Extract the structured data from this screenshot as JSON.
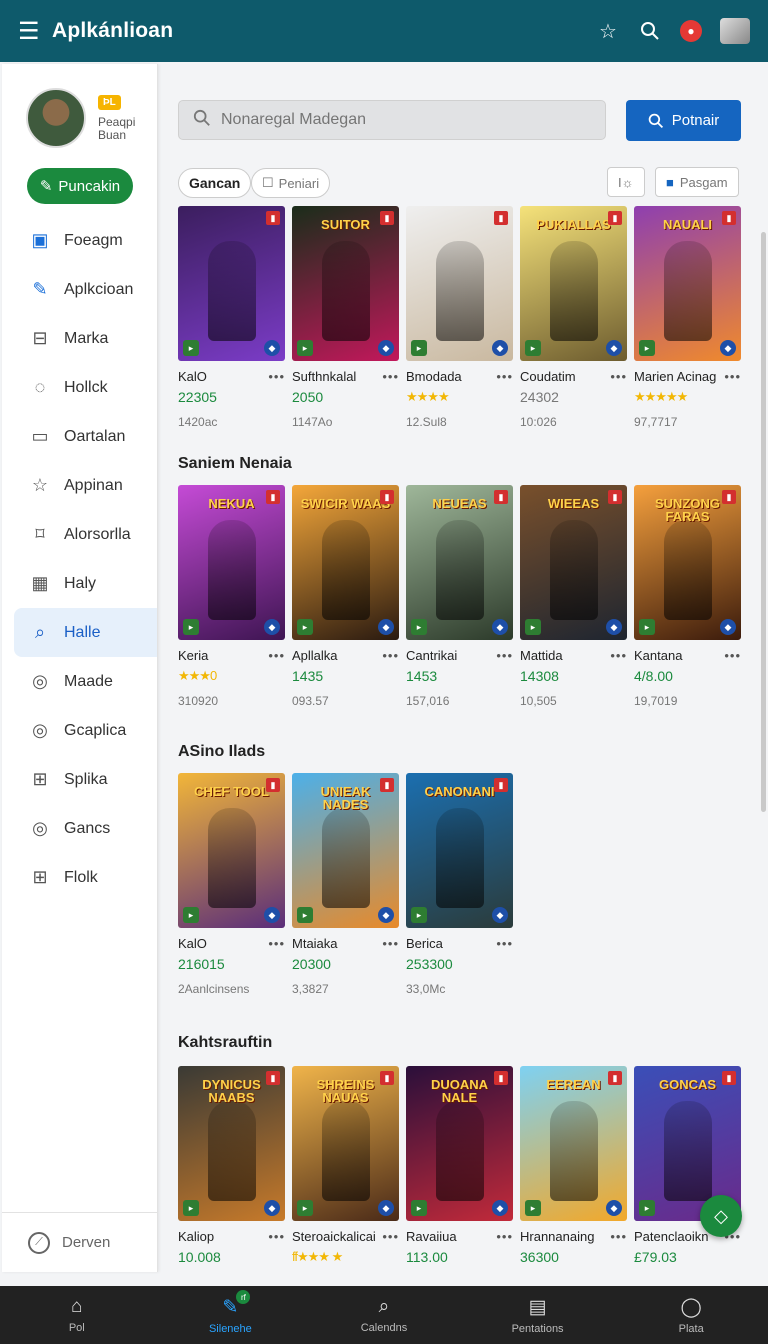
{
  "topbar": {
    "title": "Aplkánlioan",
    "menu_icon": "hamburger-icon",
    "icons": [
      "star-icon",
      "search-icon",
      "notification-icon",
      "avatar-icon"
    ]
  },
  "sidebar": {
    "profile_badge": "ÞL",
    "profile_name": "Peaqpi",
    "profile_sub": "Buan",
    "primary_button": "Puncakin",
    "items": [
      {
        "label": "Foeagm",
        "icon": "image-icon"
      },
      {
        "label": "Aplkcioan",
        "icon": "pen-icon"
      },
      {
        "label": "Marka",
        "icon": "bag-icon"
      },
      {
        "label": "Hollck",
        "icon": "chat-icon"
      },
      {
        "label": "Oartalan",
        "icon": "tray-icon"
      },
      {
        "label": "Appinan",
        "icon": "star-icon"
      },
      {
        "label": "Alorsorlla",
        "icon": "tag-icon"
      },
      {
        "label": "Haly",
        "icon": "calendar-icon"
      },
      {
        "label": "Halle",
        "icon": "search-icon"
      },
      {
        "label": "Maade",
        "icon": "compass-icon"
      },
      {
        "label": "Gcaplica",
        "icon": "compass-icon"
      },
      {
        "label": "Splika",
        "icon": "gift-icon"
      },
      {
        "label": "Gancs",
        "icon": "compass-icon"
      },
      {
        "label": "Flolk",
        "icon": "gift-icon"
      }
    ],
    "active_index": 8,
    "footer": "Derven"
  },
  "search": {
    "placeholder": "Nonaregal Madegan",
    "button": "Potnair"
  },
  "filters": {
    "selected": "Gancan",
    "chip2": "Peniari",
    "chip3": "I☼",
    "chip4": "Pasgam"
  },
  "sections": [
    {
      "title": "",
      "cards": [
        {
          "name": "KalO",
          "value": "22305",
          "sub": "1420ac",
          "colors": [
            "#3b1e5e",
            "#7b3cc7"
          ]
        },
        {
          "name": "Sufthnkalal",
          "value": "2050",
          "sub": "1147Ao",
          "colors": [
            "#1a2d1a",
            "#c2185b"
          ]
        },
        {
          "name": "Bmodada",
          "stars": "★★★★",
          "sub": "12.Sul8",
          "colors": [
            "#efefef",
            "#c9b89f"
          ]
        },
        {
          "name": "Coudatim",
          "value": "24302",
          "value_gray": true,
          "sub": "10:026",
          "colors": [
            "#f5e27a",
            "#6d5c2f"
          ]
        },
        {
          "name": "Marien Acinag",
          "stars": "★★★★★",
          "sub": "97,7717",
          "colors": [
            "#8e3fb0",
            "#f08a2c"
          ]
        }
      ]
    },
    {
      "title": "Saniem Nenaia",
      "cards": [
        {
          "name": "Keria",
          "stars": "★★★0",
          "sub": "310920",
          "colors": [
            "#c54bd6",
            "#3e1552"
          ]
        },
        {
          "name": "Apllalka",
          "value": "1435",
          "sub": "093.57",
          "colors": [
            "#f4a73a",
            "#2a1a10"
          ]
        },
        {
          "name": "Cantrikai",
          "value": "1453",
          "sub": "157,016",
          "colors": [
            "#9fb79a",
            "#2c3a2a"
          ]
        },
        {
          "name": "Mattida",
          "value": "14308",
          "sub": "10,505",
          "colors": [
            "#79502c",
            "#1e2530"
          ]
        },
        {
          "name": "Kantana",
          "value": "4/8.00",
          "sub": "19,7019",
          "colors": [
            "#f5a03d",
            "#3b1b0c"
          ]
        }
      ]
    },
    {
      "title": "ASino Ilads",
      "cards": [
        {
          "name": "KalO",
          "value": "216015",
          "sub": "2Aanlcinsens",
          "colors": [
            "#f2b639",
            "#5a2d7a"
          ]
        },
        {
          "name": "Mtaiaka",
          "value": "20300",
          "sub": "3,3827",
          "colors": [
            "#4cb0e9",
            "#e88a2a"
          ]
        },
        {
          "name": "Berica",
          "value": "253300",
          "sub": "33,0Mc",
          "colors": [
            "#1b6fb0",
            "#2b3b3a"
          ]
        }
      ]
    },
    {
      "title": "Kahtsrauftin",
      "cards": [
        {
          "name": "Kaliop",
          "value": "10.008",
          "sub": "",
          "colors": [
            "#3a3a35",
            "#c77a2a"
          ]
        },
        {
          "name": "Steroaickalicai",
          "stars": "ff★★★ ★",
          "sub": "",
          "colors": [
            "#f0b44a",
            "#4a2a18"
          ]
        },
        {
          "name": "Ravaiiua",
          "value": "113.00",
          "sub": "",
          "colors": [
            "#2a0f3a",
            "#c22a3a"
          ]
        },
        {
          "name": "Hrannanaing",
          "value": "36300",
          "sub": "",
          "colors": [
            "#7ed1f2",
            "#f2a82a"
          ]
        },
        {
          "name": "Patenclaoikn",
          "value": "£79.03",
          "sub": "",
          "colors": [
            "#3a4fb8",
            "#6a2a8a"
          ]
        }
      ]
    }
  ],
  "card_titles": [
    "",
    "SUITOR",
    "",
    "PUKIALLAS",
    "NAUALI",
    "NEKUA",
    "SWICIR WAAS",
    "NEUEAS",
    "WIEEAS",
    "SUNZONG FARAS",
    "CHEF TOOL",
    "UNIEAK NADES",
    "CANONANI",
    "DYNICUS NAABS",
    "SHREINS NAUAS",
    "DUOANA NALE",
    "EEREAN",
    "GONCAS"
  ],
  "bottomnav": [
    {
      "label": "Pol",
      "icon": "home-icon"
    },
    {
      "label": "Silenehe",
      "icon": "edit-icon",
      "badge": "rf"
    },
    {
      "label": "Calendns",
      "icon": "search-icon"
    },
    {
      "label": "Pentations",
      "icon": "briefcase-icon"
    },
    {
      "label": "Plata",
      "icon": "person-icon"
    }
  ],
  "fab_icon": "diamond-icon"
}
